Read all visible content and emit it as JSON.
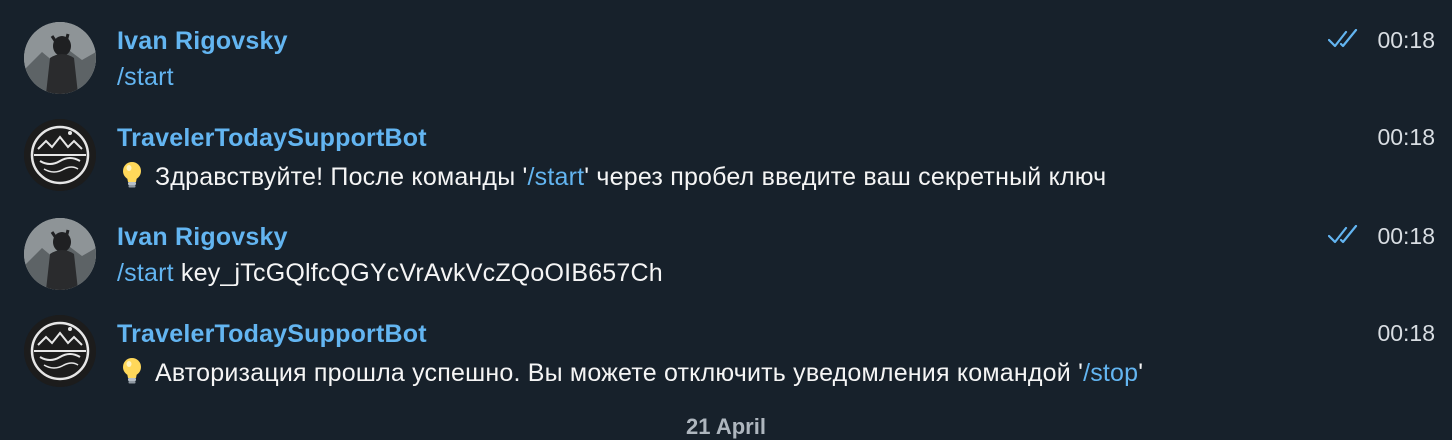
{
  "colors": {
    "background": "#17212b",
    "accent": "#63b5f1",
    "text": "#f5f5f5"
  },
  "messages": [
    {
      "sender": "Ivan Rigovsky",
      "avatar": "user-photo",
      "text_command": "/start",
      "text_rest": "",
      "time": "00:18",
      "status_icon": "double-check-icon"
    },
    {
      "sender": "TravelerTodaySupportBot",
      "avatar": "bot-logo",
      "icon": "lightbulb-icon",
      "text_before": "Здравствуйте! После команды '",
      "text_command": "/start",
      "text_after": "' через пробел введите ваш секретный ключ",
      "time": "00:18"
    },
    {
      "sender": "Ivan Rigovsky",
      "avatar": "user-photo",
      "text_command": "/start",
      "text_rest": " key_jTcGQlfcQGYcVrAvkVcZQoOIB657Ch",
      "time": "00:18",
      "status_icon": "double-check-icon"
    },
    {
      "sender": "TravelerTodaySupportBot",
      "avatar": "bot-logo",
      "icon": "lightbulb-icon",
      "text_before": "Авторизация прошла успешно. Вы можете отключить уведомления командой '",
      "text_command": "/stop",
      "text_after": "'",
      "time": "00:18"
    }
  ],
  "date_separator": "21 April"
}
